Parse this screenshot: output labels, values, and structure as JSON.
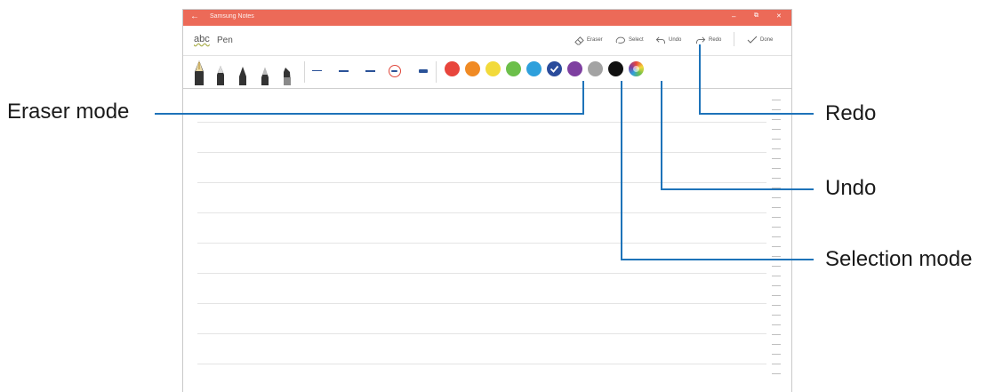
{
  "window": {
    "title": "Samsung Notes",
    "back_glyph": "←",
    "minimize_glyph": "–",
    "restore_glyph": "⧉",
    "close_glyph": "✕"
  },
  "toolbar": {
    "abc_label": "abc",
    "mode_label": "Pen",
    "eraser_label": "Eraser",
    "select_label": "Select",
    "undo_label": "Undo",
    "redo_label": "Redo",
    "done_label": "Done"
  },
  "pens": [
    "fountain-pen",
    "pen",
    "pencil",
    "brush",
    "marker"
  ],
  "stroke_sizes": [
    "size-1",
    "size-2",
    "size-3",
    "size-4",
    "size-5"
  ],
  "colors": {
    "palette": [
      "#e8453c",
      "#f08a24",
      "#f2da3a",
      "#6cbf4a",
      "#2ea0dc",
      "#2a4b9b",
      "#7e3fa0",
      "#a3a3a3",
      "#111111"
    ],
    "selected": "#2a4b9b",
    "accent": "#ec6a58"
  },
  "callouts": {
    "eraser": "Eraser mode",
    "redo": "Redo",
    "undo": "Undo",
    "selection": "Selection mode"
  }
}
